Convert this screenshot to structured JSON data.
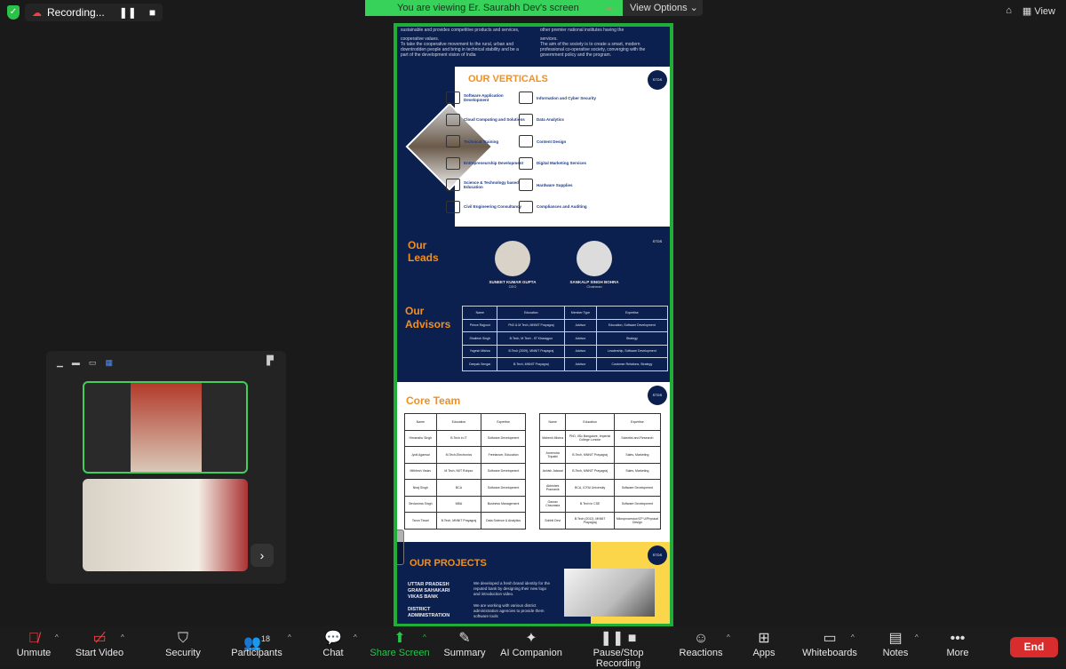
{
  "topbar": {
    "recording_label": "Recording...",
    "pause_icon": "pause-icon",
    "stop_icon": "stop-icon",
    "view_label": "View"
  },
  "banner": {
    "text": "You are viewing Er. Saurabh Dev's screen",
    "view_options": "View Options"
  },
  "doc": {
    "intro_left": [
      "sustainable and provides competitive products and services,",
      "cooperative values.",
      "To take the cooperative movement to the rural, urban and downtrodden people and bring in technical stability and be a part of the development vision of India"
    ],
    "intro_right": [
      "other premier national institutes having the",
      "services.",
      "The aim of the society is to create a smart, modern professional co-operative society, converging with the government policy and the program."
    ],
    "logo_text": "STDS",
    "verticals_title": "OUR VERTICALS",
    "verticals": [
      {
        "label": "Software Application Development",
        "icon": "software-icon"
      },
      {
        "label": "Information and Cyber Security",
        "icon": "security-icon"
      },
      {
        "label": "Cloud Computing and Solutions",
        "icon": "cloud-icon"
      },
      {
        "label": "Data Analytics",
        "icon": "analytics-icon"
      },
      {
        "label": "Technical Training",
        "icon": "training-icon"
      },
      {
        "label": "Content Design",
        "icon": "content-icon"
      },
      {
        "label": "Entrepreneurship Development",
        "icon": "entrepreneurship-icon"
      },
      {
        "label": "Digital Marketing Services",
        "icon": "marketing-icon"
      },
      {
        "label": "Science & Technology based Education",
        "icon": "atom-icon"
      },
      {
        "label": "Hardware Supplies",
        "icon": "hardware-icon"
      },
      {
        "label": "Civil Engineering Consultancy",
        "icon": "crane-icon"
      },
      {
        "label": "Compliances and Auditing",
        "icon": "audit-icon"
      }
    ],
    "leads_title": "Our Leads",
    "leads": [
      {
        "name": "SUNEET KUMAR GUPTA",
        "role": "CEO"
      },
      {
        "name": "SANKALP SINGH BOHRA",
        "role": "Chairman"
      }
    ],
    "advisors_title": "Our Advisors",
    "advisors_headers": [
      "Name",
      "Education",
      "Member Type",
      "Expertise"
    ],
    "advisors": [
      [
        "Prince Rajpoot",
        "PhD & M.Tech, MNNIT Prayagraj",
        "Advisor",
        "Education, Software Development"
      ],
      [
        "Shailesh Singh",
        "B.Tech, M.Tech - IIT Kharagpur",
        "Advisor",
        "Strategy"
      ],
      [
        "Yogesh Mishra",
        "B.Tech (2009), MNNIT Prayagraj",
        "Advisor",
        "Leadership, Software Development"
      ],
      [
        "Deepak Sengar",
        "B.Tech, MNNIT Prayagraj",
        "Advisor",
        "Customer Relations, Strategy"
      ]
    ],
    "core_title": "Core Team",
    "core_headers": [
      "Name",
      "Education",
      "Expertise"
    ],
    "core_left": [
      [
        "Himanshu Singh",
        "B.Tech in IT",
        "Software Development"
      ],
      [
        "Jyoti Agarwal",
        "M.Tech-Electronics",
        "Freelancer, Education"
      ],
      [
        "Mithlesh Yadav",
        "M.Tech, NIIT Rohpur",
        "Software Development"
      ],
      [
        "Niraj Singh",
        "BCA",
        "Software Development"
      ],
      [
        "Sevlamma Singh",
        "MBA",
        "Business Management"
      ],
      [
        "Tarun Tiwari",
        "B.Tech, MNNIT Prayagraj",
        "Data Science & Analytics"
      ]
    ],
    "core_right": [
      [
        "Mahesh Mishra",
        "PhD, IISc Bangalore, Imperial College London",
        "Scientist and Research"
      ],
      [
        "Amrendra Tripathi",
        "B.Tech, MNNIT Prayagraj",
        "Sales, Marketing"
      ],
      [
        "Ashish Jaiswal",
        "B.Tech, MNNIT Prayagraj",
        "Sales, Marketing"
      ],
      [
        "Abhishek Pramanik",
        "BCA, ICFAI University",
        "Software Development"
      ],
      [
        "Gaurav Chaurasia",
        "B.Tech in CSE",
        "Software Development"
      ],
      [
        "Sobhit Devi",
        "B.Tech (2012), MNNIT Prayagraj",
        "Microprocessor/CP U/Physical Design"
      ]
    ],
    "projects_title": "OUR PROJECTS",
    "projects": [
      {
        "name": "UTTAR PRADESH GRAM SAHAKARI VIKAS BANK",
        "desc": "We developed a fresh brand identity for the reputed bank by designing their new logo and introduction video."
      },
      {
        "name": "DISTRICT ADMINISTRATION",
        "desc": "We are working with various district administration agencies to provide them software tools"
      }
    ]
  },
  "video_panel": {
    "participants": [
      {
        "name": "participant-1"
      },
      {
        "name": "participant-2"
      }
    ]
  },
  "toolbar": {
    "unmute": "Unmute",
    "start_video": "Start Video",
    "security": "Security",
    "participants": "Participants",
    "participants_count": "18",
    "chat": "Chat",
    "share_screen": "Share Screen",
    "summary": "Summary",
    "ai_companion": "AI Companion",
    "recording": "Pause/Stop Recording",
    "reactions": "Reactions",
    "apps": "Apps",
    "whiteboards": "Whiteboards",
    "notes": "Notes",
    "more": "More",
    "end": "End"
  },
  "colors": {
    "accent_green": "#1fae38",
    "navy": "#0c2050",
    "orange": "#f0901e",
    "end_red": "#d92d2d",
    "share_green": "#2ac34c"
  }
}
